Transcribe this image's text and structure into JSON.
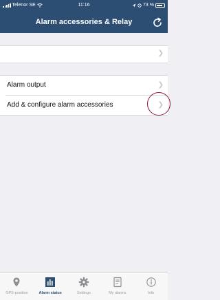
{
  "status_bar": {
    "carrier": "Telenor SE",
    "time": "11:16",
    "battery": "73 %"
  },
  "nav": {
    "title": "Alarm accessories & Relay",
    "refresh_icon": "refresh-icon"
  },
  "group1": {
    "items": [
      {
        "label": ""
      }
    ]
  },
  "group2": {
    "items": [
      {
        "label": "Alarm output"
      },
      {
        "label": "Add & configure alarm accessories"
      }
    ]
  },
  "tabs": [
    {
      "label": "GPS-position",
      "icon": "location-pin-icon"
    },
    {
      "label": "Alarm status",
      "icon": "bar-chart-icon",
      "active": true
    },
    {
      "label": "Settings",
      "icon": "gear-icon"
    },
    {
      "label": "My alarms",
      "icon": "list-icon"
    },
    {
      "label": "Info",
      "icon": "info-icon"
    }
  ],
  "colors": {
    "header": "#2c4e73",
    "background": "#efeff4",
    "highlight": "#8b1a3a"
  }
}
